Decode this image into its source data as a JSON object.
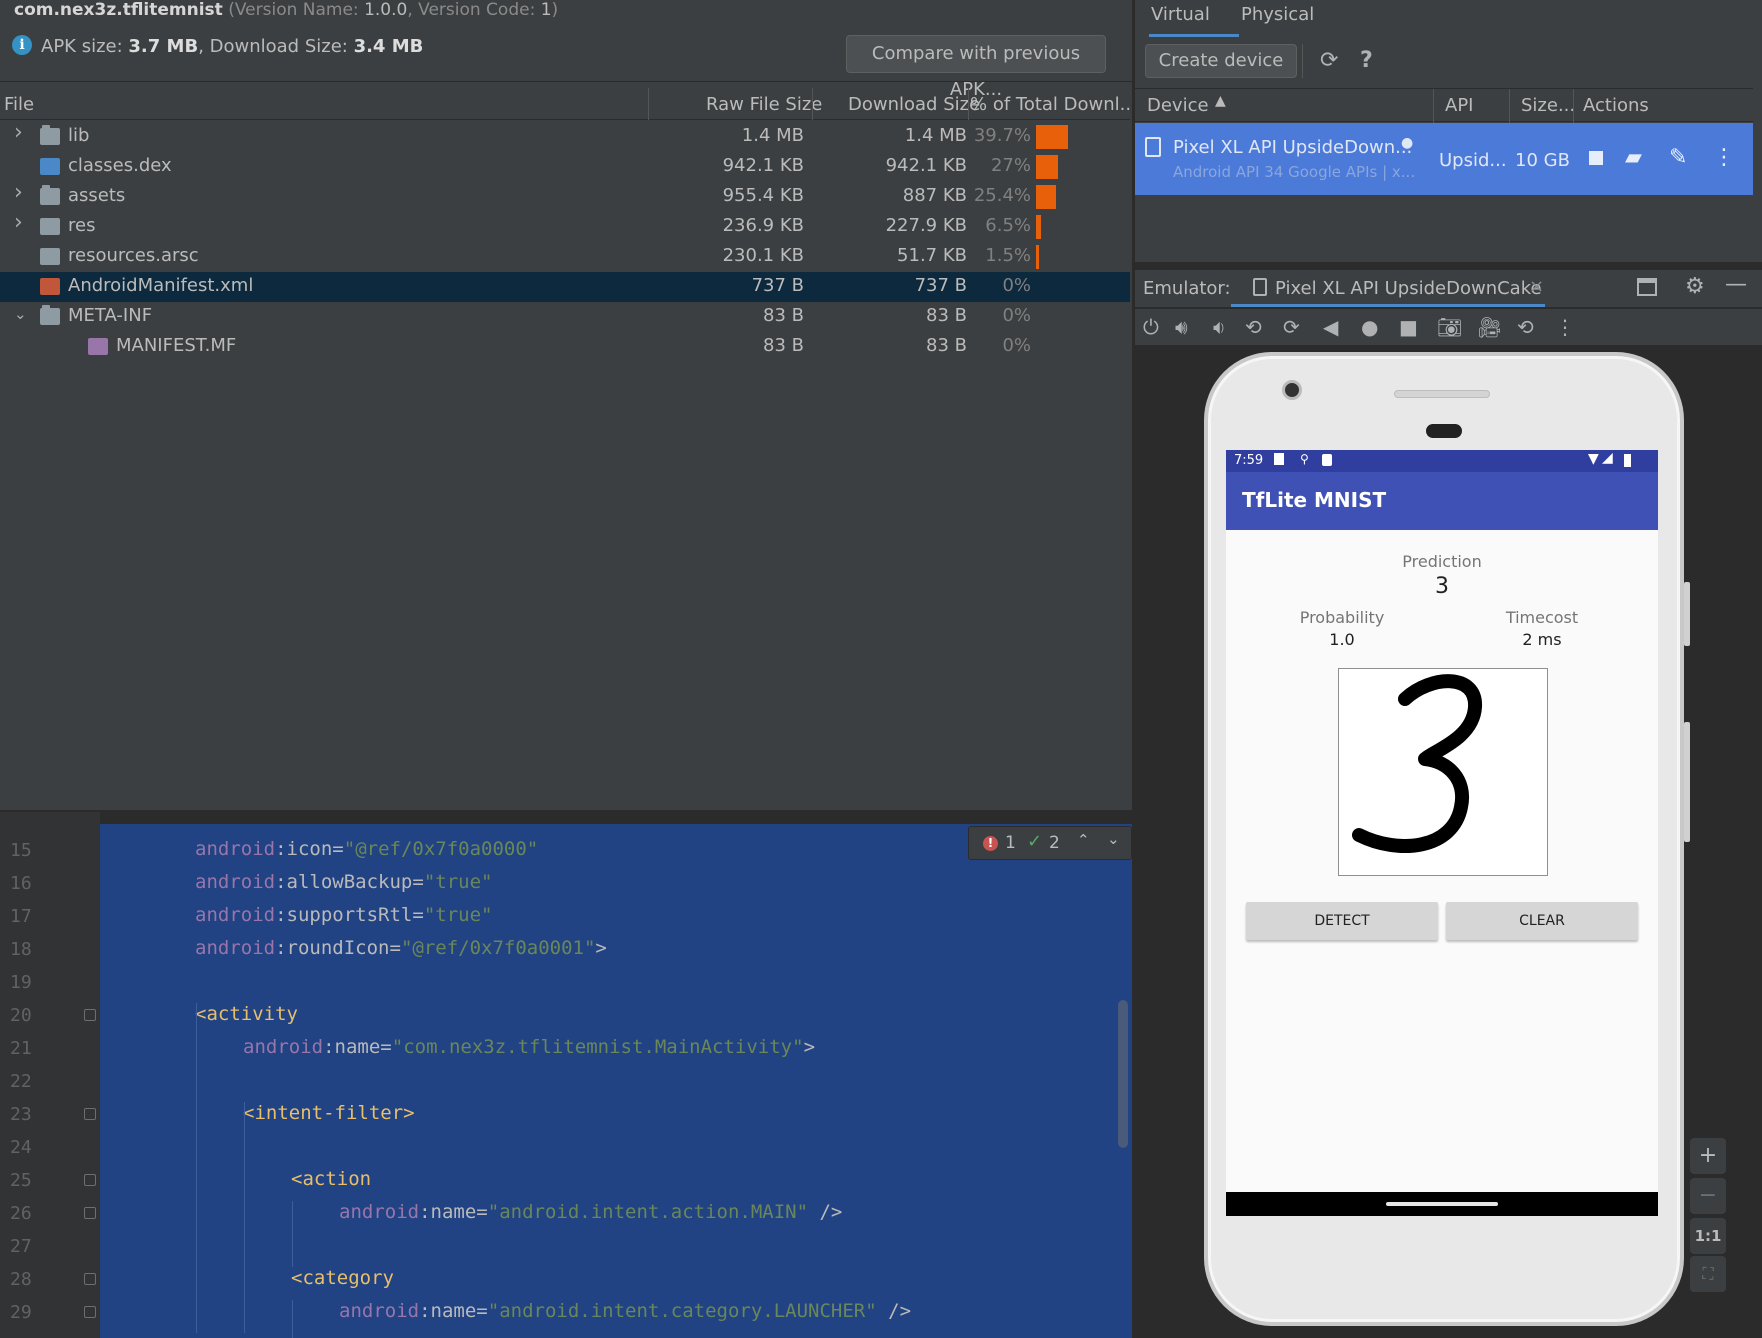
{
  "apk": {
    "package": "com.nex3z.tflitemnist",
    "version_prefix": "(Version Name: ",
    "version_name": "1.0.0",
    "version_code_prefix": ", Version Code: ",
    "version_code": "1",
    "version_suffix": ")",
    "apk_size_label": "APK size: ",
    "apk_size": "3.7 MB",
    "download_size_label": ", Download Size: ",
    "download_size": "3.4 MB",
    "compare_button": "Compare with previous APK...",
    "columns": {
      "file": "File",
      "raw": "Raw File Size",
      "download": "Download Size",
      "percent": "% of Total Downl..."
    },
    "files": [
      {
        "name": "lib",
        "raw": "1.4 MB",
        "download": "1.4 MB",
        "percent": "39.7%",
        "share": 0.397,
        "type": "folder",
        "expand": "collapsed",
        "depth": 0
      },
      {
        "name": "classes.dex",
        "raw": "942.1 KB",
        "download": "942.1 KB",
        "percent": "27%",
        "share": 0.27,
        "type": "dex",
        "expand": "none",
        "depth": 0
      },
      {
        "name": "assets",
        "raw": "955.4 KB",
        "download": "887 KB",
        "percent": "25.4%",
        "share": 0.254,
        "type": "folder",
        "expand": "collapsed",
        "depth": 0
      },
      {
        "name": "res",
        "raw": "236.9 KB",
        "download": "227.9 KB",
        "percent": "6.5%",
        "share": 0.065,
        "type": "res",
        "expand": "collapsed",
        "depth": 0
      },
      {
        "name": "resources.arsc",
        "raw": "230.1 KB",
        "download": "51.7 KB",
        "percent": "1.5%",
        "share": 0.015,
        "type": "arsc",
        "expand": "none",
        "depth": 0
      },
      {
        "name": "AndroidManifest.xml",
        "raw": "737 B",
        "download": "737 B",
        "percent": "0%",
        "share": 0,
        "type": "xml",
        "expand": "none",
        "depth": 0,
        "selected": true
      },
      {
        "name": "META-INF",
        "raw": "83 B",
        "download": "83 B",
        "percent": "0%",
        "share": 0,
        "type": "folder",
        "expand": "expanded",
        "depth": 0
      },
      {
        "name": "MANIFEST.MF",
        "raw": "83 B",
        "download": "83 B",
        "percent": "0%",
        "share": 0,
        "type": "mf",
        "expand": "none",
        "depth": 1
      }
    ]
  },
  "editor": {
    "errors": "1",
    "warnings": "2",
    "lines": [
      {
        "n": "15",
        "indent": 0,
        "parts": [
          [
            "attr",
            "android"
          ],
          [
            "punc",
            ":"
          ],
          [
            "name",
            "icon"
          ],
          [
            "punc",
            "="
          ],
          [
            "val",
            "\"@ref/0x7f0a0000\""
          ]
        ]
      },
      {
        "n": "16",
        "indent": 0,
        "parts": [
          [
            "attr",
            "android"
          ],
          [
            "punc",
            ":"
          ],
          [
            "name",
            "allowBackup"
          ],
          [
            "punc",
            "="
          ],
          [
            "val",
            "\"true\""
          ]
        ]
      },
      {
        "n": "17",
        "indent": 0,
        "parts": [
          [
            "attr",
            "android"
          ],
          [
            "punc",
            ":"
          ],
          [
            "name",
            "supportsRtl"
          ],
          [
            "punc",
            "="
          ],
          [
            "val",
            "\"true\""
          ]
        ]
      },
      {
        "n": "18",
        "indent": 0,
        "parts": [
          [
            "attr",
            "android"
          ],
          [
            "punc",
            ":"
          ],
          [
            "name",
            "roundIcon"
          ],
          [
            "punc",
            "="
          ],
          [
            "val",
            "\"@ref/0x7f0a0001\""
          ],
          [
            "punc",
            ">"
          ]
        ]
      },
      {
        "n": "19",
        "indent": 0,
        "parts": []
      },
      {
        "n": "20",
        "indent": 0,
        "parts": [
          [
            "tag",
            "<activity"
          ]
        ],
        "fold": true
      },
      {
        "n": "21",
        "indent": 1,
        "parts": [
          [
            "attr",
            "android"
          ],
          [
            "punc",
            ":"
          ],
          [
            "name",
            "name"
          ],
          [
            "punc",
            "="
          ],
          [
            "val",
            "\"com.nex3z.tflitemnist.MainActivity\""
          ],
          [
            "punc",
            ">"
          ]
        ]
      },
      {
        "n": "22",
        "indent": 0,
        "parts": []
      },
      {
        "n": "23",
        "indent": 1,
        "parts": [
          [
            "tag",
            "<intent-filter>"
          ]
        ],
        "fold": true
      },
      {
        "n": "24",
        "indent": 0,
        "parts": []
      },
      {
        "n": "25",
        "indent": 2,
        "parts": [
          [
            "tag",
            "<action"
          ]
        ],
        "fold": true
      },
      {
        "n": "26",
        "indent": 3,
        "parts": [
          [
            "attr",
            "android"
          ],
          [
            "punc",
            ":"
          ],
          [
            "name",
            "name"
          ],
          [
            "punc",
            "="
          ],
          [
            "val",
            "\"android.intent.action.MAIN\""
          ],
          [
            "punc",
            " />"
          ]
        ],
        "fold": true
      },
      {
        "n": "27",
        "indent": 0,
        "parts": []
      },
      {
        "n": "28",
        "indent": 2,
        "parts": [
          [
            "tag",
            "<category"
          ]
        ],
        "fold": true
      },
      {
        "n": "29",
        "indent": 3,
        "parts": [
          [
            "attr",
            "android"
          ],
          [
            "punc",
            ":"
          ],
          [
            "name",
            "name"
          ],
          [
            "punc",
            "="
          ],
          [
            "val",
            "\"android.intent.category.LAUNCHER\""
          ],
          [
            "punc",
            " />"
          ]
        ],
        "fold": true
      }
    ]
  },
  "device_manager": {
    "tabs": [
      "Virtual",
      "Physical"
    ],
    "active_tab": "Virtual",
    "create_button": "Create device",
    "columns": {
      "device": "Device",
      "api": "API",
      "size": "Size...",
      "actions": "Actions"
    },
    "device": {
      "name": "Pixel XL API UpsideDown...",
      "subtitle": "Android API 34 Google APIs | x...",
      "api": "Upsid...",
      "size": "10 GB"
    }
  },
  "emulator": {
    "label": "Emulator:",
    "tab": "Pixel XL API UpsideDownCake",
    "zoom_in": "+",
    "zoom_out": "−",
    "zoom_one": "1:1"
  },
  "app": {
    "time": "7:59",
    "title": "TfLite MNIST",
    "prediction_label": "Prediction",
    "prediction": "3",
    "probability_label": "Probability",
    "probability": "1.0",
    "timecost_label": "Timecost",
    "timecost": "2 ms",
    "detect_button": "DETECT",
    "clear_button": "CLEAR"
  },
  "colors": {
    "accent": "#4a88c7",
    "bar": "#e8600a",
    "selection": "#0d293e",
    "device_row": "#4c7ad9",
    "app_bar": "#3f51b5",
    "status_bar": "#303f9f"
  }
}
